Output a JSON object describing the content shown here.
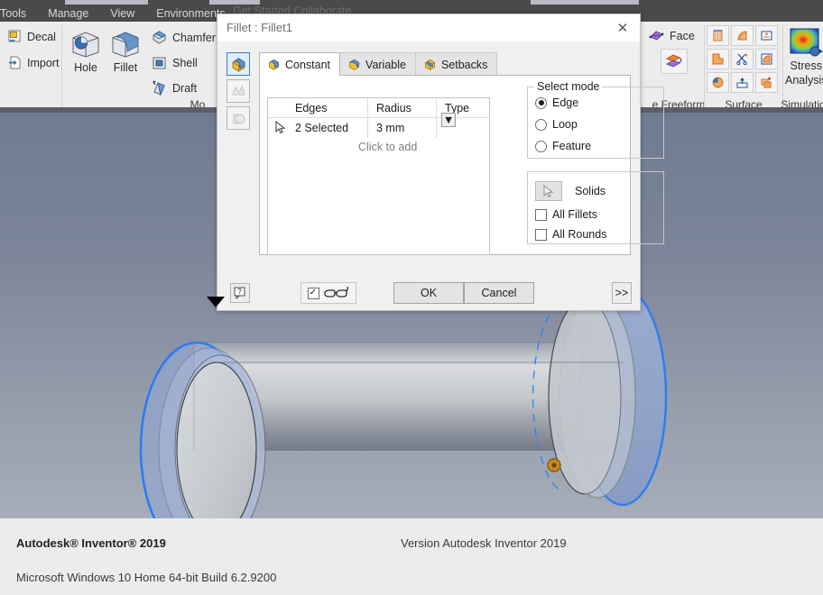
{
  "ribbon": {
    "menu_items": [
      "Tools",
      "Manage",
      "View",
      "Environments"
    ],
    "ghost_tab": "Get Started   Collaborate",
    "panels": {
      "insert_label": "",
      "modify_label": "Mo",
      "freeform_label": "e Freeform",
      "surface_label": "Surface",
      "simulation_label": "Simulatio"
    },
    "buttons": {
      "decal": "Decal",
      "import": "Import",
      "hole": "Hole",
      "fillet": "Fillet",
      "chamfer": "Chamfer",
      "shell": "Shell",
      "draft": "Draft",
      "face": "Face",
      "stress_analysis_line1": "Stress",
      "stress_analysis_line2": "Analysis"
    }
  },
  "dialog": {
    "title": "Fillet : Fillet1",
    "close_label": "✕",
    "side_buttons": [
      "edge-fillet-mode",
      "face-fillet-mode",
      "full-round-fillet-mode"
    ],
    "tabs": [
      {
        "label": "Constant",
        "active": true
      },
      {
        "label": "Variable",
        "active": false
      },
      {
        "label": "Setbacks",
        "active": false
      }
    ],
    "edges_table": {
      "headers": [
        "Edges",
        "Radius",
        "Type"
      ],
      "rows": [
        {
          "edges": "2 Selected",
          "radius": "3 mm",
          "type": "fillet-type-icon"
        }
      ],
      "add_hint": "Click to add"
    },
    "select_mode": {
      "legend": "Select mode",
      "options": [
        {
          "label": "Edge",
          "selected": true
        },
        {
          "label": "Loop",
          "selected": false
        },
        {
          "label": "Feature",
          "selected": false
        }
      ]
    },
    "solids": {
      "label": "Solids",
      "checkboxes": [
        {
          "label": "All Fillets",
          "checked": false
        },
        {
          "label": "All Rounds",
          "checked": false
        }
      ]
    },
    "footer": {
      "help_label": "?",
      "preview_checked": true,
      "ok_label": "OK",
      "cancel_label": "Cancel",
      "expand_label": ">>"
    }
  },
  "footer": {
    "product": "Autodesk® Inventor® 2019",
    "version": "Version Autodesk Inventor 2019",
    "os": "Microsoft Windows 10 Home 64-bit Build 6.2.9200"
  },
  "colors": {
    "accent_blue": "#2b7cf0",
    "viewport_top": "#6f7b91",
    "viewport_bottom": "#a6adb8",
    "ribbon_dark": "#4a4a4a",
    "highlight_orange": "#c8891f"
  }
}
